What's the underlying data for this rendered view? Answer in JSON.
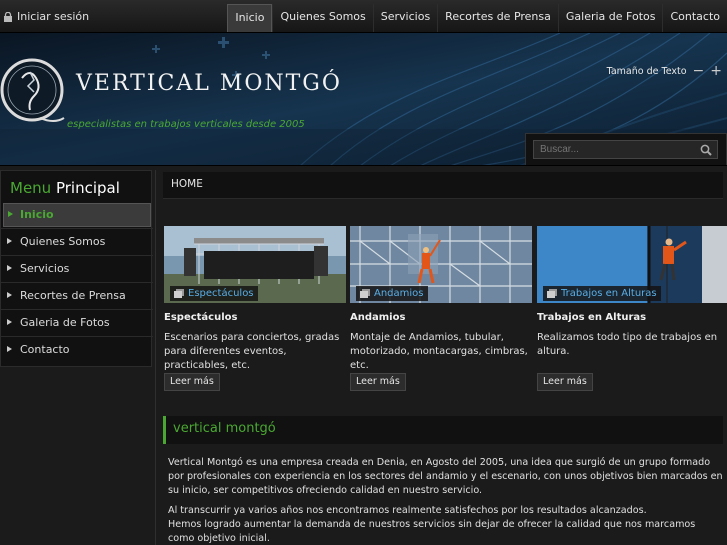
{
  "topbar": {
    "login_label": "Iniciar sesión",
    "nav": [
      "Inicio",
      "Quienes Somos",
      "Servicios",
      "Recortes de Prensa",
      "Galeria de Fotos",
      "Contacto"
    ]
  },
  "header": {
    "logo_title": "VERTICAL MONTGÓ",
    "tagline": "especialistas en trabajos verticales desde 2005",
    "text_size_label": "Tamaño de Texto",
    "search_placeholder": "Buscar..."
  },
  "sidebar": {
    "title_prefix": "Menu",
    "title_main": "Principal",
    "items": [
      "Inicio",
      "Quienes Somos",
      "Servicios",
      "Recortes de Prensa",
      "Galeria de Fotos",
      "Contacto"
    ]
  },
  "breadcrumb": "HOME",
  "cards": [
    {
      "tag": "Espectáculos",
      "title": "Espectáculos",
      "text": "Escenarios para conciertos, gradas para diferentes eventos, practicables, etc.",
      "more": "Leer más"
    },
    {
      "tag": "Andamios",
      "title": "Andamios",
      "text": "Montaje de Andamios, tubular, motorizado, montacargas, cimbras, etc.",
      "more": "Leer más"
    },
    {
      "tag": "Trabajos en Alturas",
      "title": "Trabajos en Alturas",
      "text": "Realizamos todo tipo de trabajos en altura.",
      "more": "Leer más"
    }
  ],
  "section": {
    "title": "vertical montgó",
    "paragraphs": [
      "Vertical Montgó es una empresa creada en Denia, en Agosto del 2005, una idea que surgió de un grupo formado por profesionales con experiencia en los sectores del andamio y el escenario, con unos objetivos bien marcados en su inicio, ser competitivos ofreciendo calidad en nuestro servicio.",
      "Al transcurrir ya varios años nos encontramos realmente satisfechos por los resultados alcanzados.",
      "Hemos logrado aumentar la demanda de nuestros servicios sin dejar de ofrecer la calidad que nos marcamos como objetivo inicial."
    ]
  },
  "colors": {
    "accent_green": "#4aa832",
    "link_blue": "#5aaee6",
    "background": "#1b1b1b"
  }
}
